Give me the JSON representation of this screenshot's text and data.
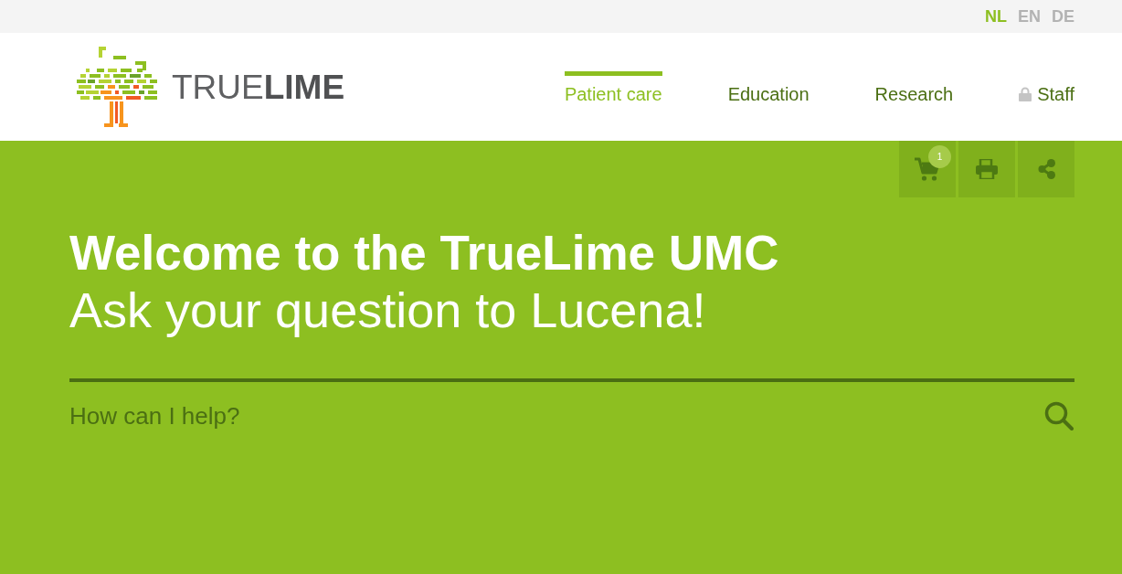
{
  "top_bar": {
    "languages": [
      {
        "label": "NL",
        "selected": true
      },
      {
        "label": "EN",
        "selected": false
      },
      {
        "label": "DE",
        "selected": false
      }
    ]
  },
  "header": {
    "logo": {
      "text": "TRUE**LIME**"
    },
    "nav": [
      {
        "label": "Patient care",
        "selected": true,
        "locked": false
      },
      {
        "label": "Education",
        "selected": false,
        "locked": false
      },
      {
        "label": "Research",
        "selected": false,
        "locked": false
      },
      {
        "label": "Staff",
        "selected": false,
        "locked": true
      }
    ]
  },
  "hero": {
    "toolbar": [
      {
        "kind": "cart",
        "badge": "1"
      },
      {
        "kind": "print"
      },
      {
        "kind": "share"
      }
    ],
    "title": "Welcome to the TrueLime UMC",
    "subtitle": "Ask your question to Lucena!",
    "search": {
      "placeholder": "How can I help?"
    }
  }
}
